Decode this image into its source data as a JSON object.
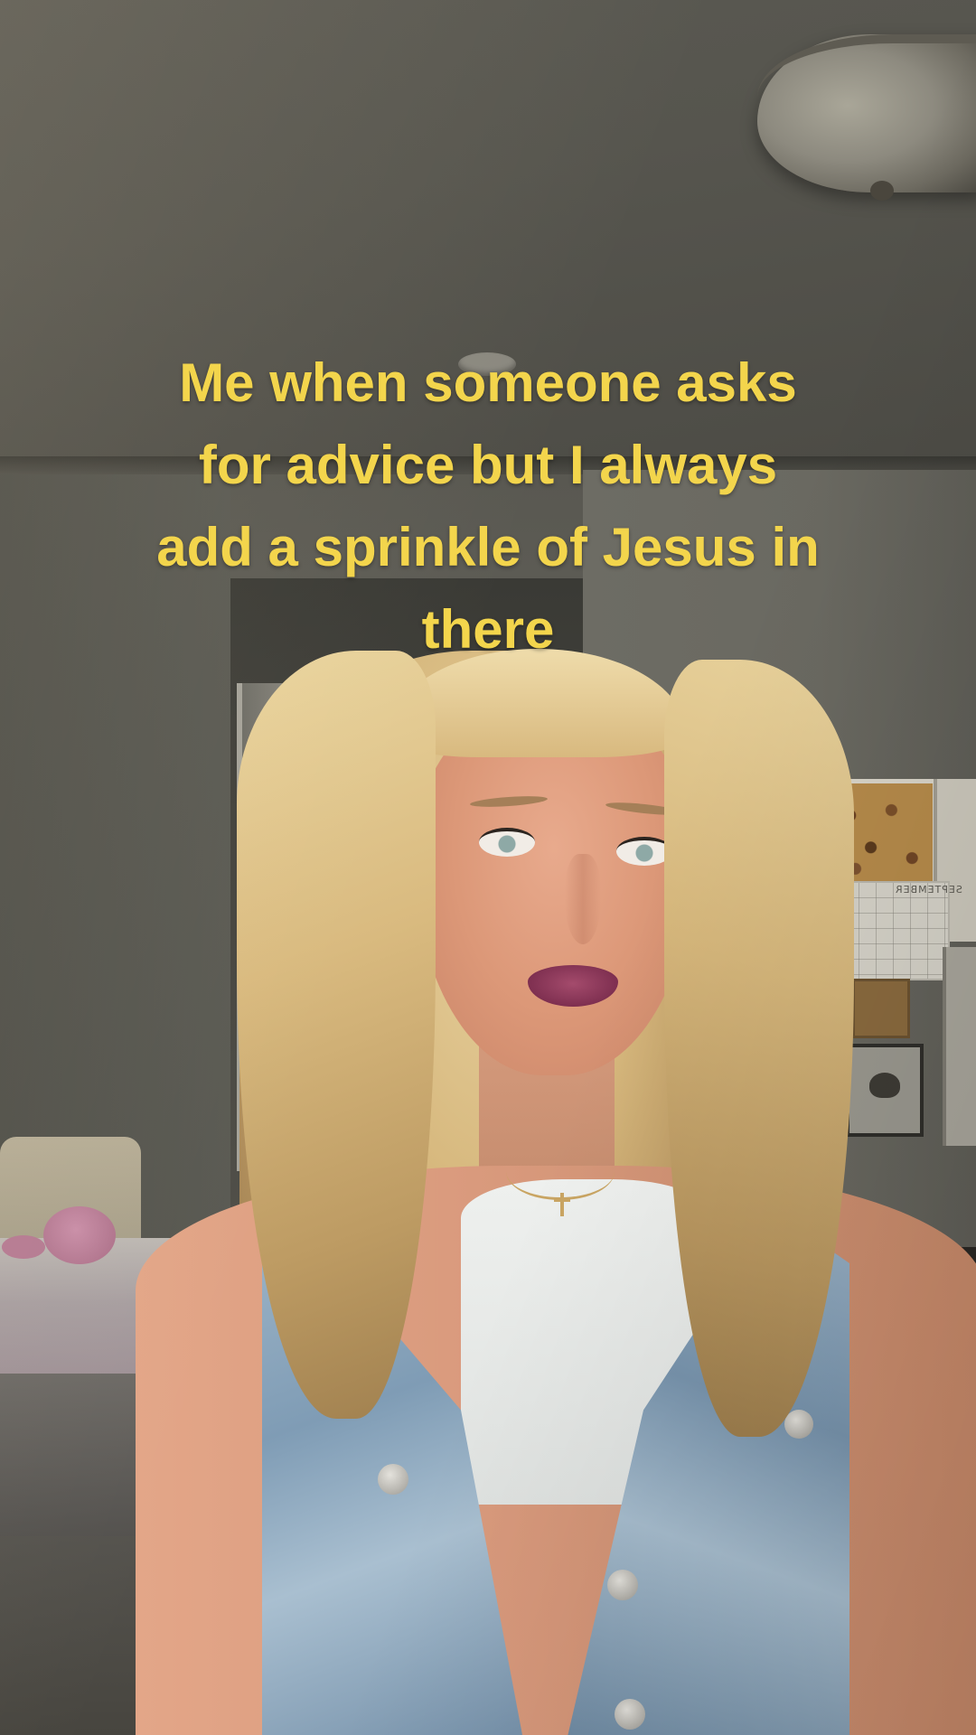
{
  "caption": {
    "lines": [
      "Me when someone asks",
      "for advice but I always",
      "add a sprinkle of Jesus in",
      "there"
    ],
    "color": "#f3d54c"
  },
  "scene": {
    "calendar_title": "SEPTEMBER"
  }
}
